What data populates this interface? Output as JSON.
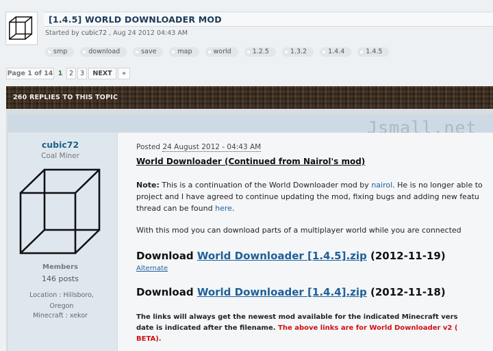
{
  "topic": {
    "title": "[1.4.5] WORLD DOWNLOADER MOD",
    "started_prefix": "Started by ",
    "started_author": "cubic72",
    "started_date": " , Aug 24 2012 04:43 AM",
    "tags": [
      "smp",
      "download",
      "save",
      "map",
      "world",
      "1.2.5",
      "1.3.2",
      "1.4.4",
      "1.4.5"
    ]
  },
  "pagination": {
    "label": "Page 1 of 14",
    "current": "1",
    "pages": [
      "2",
      "3"
    ],
    "next": "NEXT",
    "last": "»"
  },
  "replies": {
    "label": "260 REPLIES TO THIS TOPIC"
  },
  "watermark": "Jsmall.net",
  "author": {
    "name": "cubic72",
    "rank": "Coal Miner",
    "group": "Members",
    "posts": "146 posts",
    "location_label": "Location : ",
    "location_value": "Hillsboro, Oregon",
    "minecraft_label": "Minecraft : ",
    "minecraft_value": "xekor"
  },
  "post": {
    "posted_prefix": "Posted ",
    "posted_date": "24 August 2012 - 04:43 AM",
    "heading": "World Downloader (Continued from Nairol's mod)",
    "note_bold": "Note:",
    "note_line1_a": " This is a continuation of the World Downloader mod by ",
    "note_link": "nairol",
    "note_line1_b": ". He is no longer able to",
    "note_line2": "project and I have agreed to continue updating the mod, fixing bugs and adding new featu",
    "note_line3_a": "thread can be found ",
    "note_line3_link": "here",
    "note_line3_b": ".",
    "intro": "With this mod you can download parts of a multiplayer world while you are connected",
    "download_label": "Download ",
    "download1_link": "World Downloader [1.4.5].zip",
    "download1_date": " (2012-11-19)",
    "alternate": "Alternate",
    "download2_link": "World Downloader [1.4.4].zip",
    "download2_date": " (2012-11-18)",
    "bottom_line1": "The links will always get the newest mod available for the indicated Minecraft vers",
    "bottom_line2_a": "date is indicated after the filename. ",
    "bottom_line2_red": "The above links are for World Downloader v2 (",
    "bottom_line3_red": "BETA)."
  }
}
